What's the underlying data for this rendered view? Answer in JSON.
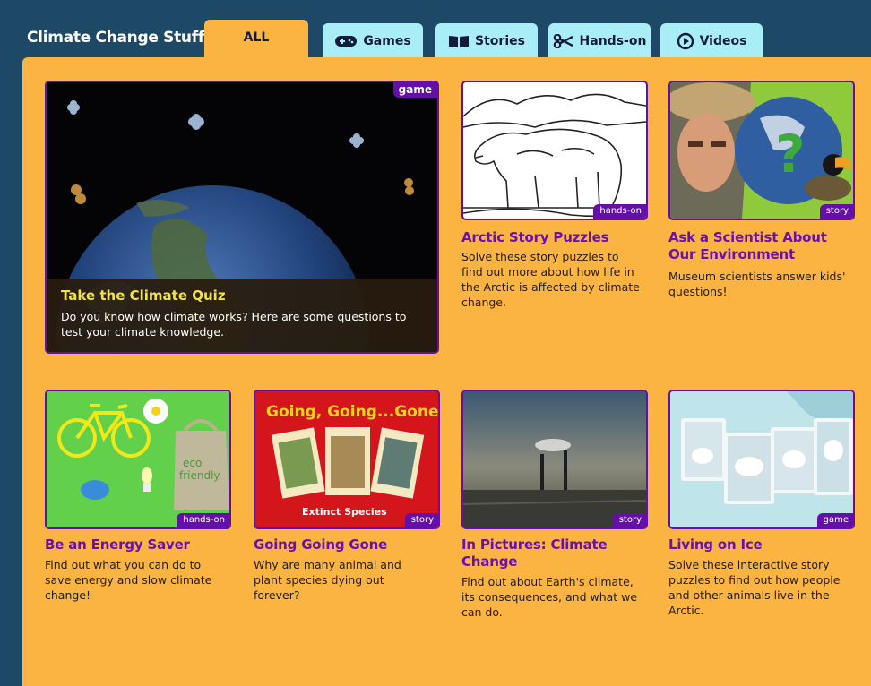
{
  "header": {
    "title": "Climate Change Stuff:"
  },
  "tabs": [
    {
      "label": "ALL",
      "icon": "",
      "active": true
    },
    {
      "label": "Games",
      "icon": "gamepad-icon",
      "active": false
    },
    {
      "label": "Stories",
      "icon": "book-icon",
      "active": false
    },
    {
      "label": "Hands-on",
      "icon": "scissors-icon",
      "active": false
    },
    {
      "label": "Videos",
      "icon": "play-icon",
      "active": false
    }
  ],
  "featured": {
    "title": "Take the Climate Quiz",
    "description": "Do you know how climate works? Here are some questions to test your climate knowledge.",
    "badge": "game"
  },
  "cards": [
    {
      "title": "Arctic Story Puzzles",
      "description": "Solve these story puzzles to find out more about how life in the Arctic is affected by climate change.",
      "badge": "hands-on"
    },
    {
      "title": "Ask a Scientist About Our Environment",
      "description": "Museum scientists answer kids' questions!",
      "badge": "story"
    },
    {
      "title": "Be an Energy Saver",
      "description": "Find out what you can do to save energy and slow climate change!",
      "badge": "hands-on",
      "thumb_text": "eco friendly"
    },
    {
      "title": "Going Going Gone",
      "description": "Why are many animal and plant species dying out forever?",
      "badge": "story",
      "thumb_text": "Going, Going...Gone!",
      "thumb_sub": "Extinct Species"
    },
    {
      "title": "In Pictures: Climate Change",
      "description": "Find out about Earth's climate, its consequences, and what we can do.",
      "badge": "story"
    },
    {
      "title": "Living on Ice",
      "description": "Solve these interactive story puzzles to find out how people and other animals live in the Arctic.",
      "badge": "game"
    }
  ],
  "colors": {
    "background": "#1d4866",
    "panel": "#fbb441",
    "tab_inactive": "#a9eef6",
    "accent": "#6410a8",
    "title": "#6a10ae"
  }
}
